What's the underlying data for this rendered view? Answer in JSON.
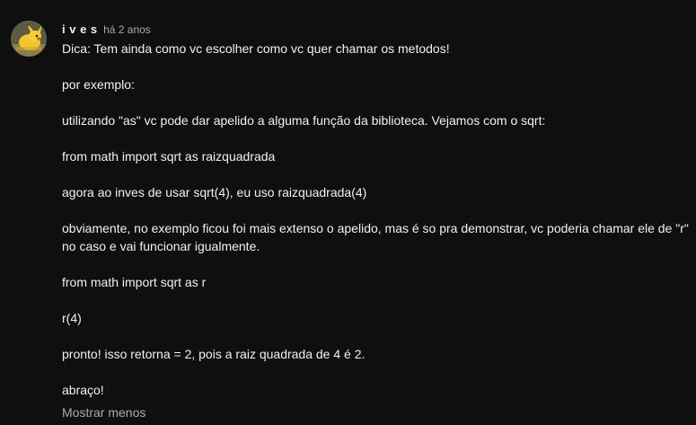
{
  "comment": {
    "author": "i v e s",
    "timestamp": "há 2 anos",
    "avatar_icon": "pikachu-avatar-icon",
    "paragraphs": [
      "Dica: Tem ainda como vc escolher como vc quer chamar os metodos!",
      "por exemplo:",
      "utilizando \"as\" vc pode dar apelido a alguma função da biblioteca. Vejamos com o sqrt:",
      "from math import sqrt as raizquadrada",
      "agora ao inves de usar sqrt(4), eu uso raizquadrada(4)",
      "obviamente, no exemplo ficou foi mais extenso o apelido, mas é so pra demonstrar, vc poderia chamar ele de \"r\" no caso e vai funcionar igualmente.",
      "from math import sqrt as r",
      "r(4)",
      "pronto! isso retorna = 2, pois a raiz quadrada de 4 é 2.",
      "abraço!"
    ],
    "show_less_label": "Mostrar menos"
  },
  "colors": {
    "background": "#0f0f0f",
    "text_primary": "#f1f1f1",
    "text_secondary": "#aaaaaa"
  }
}
